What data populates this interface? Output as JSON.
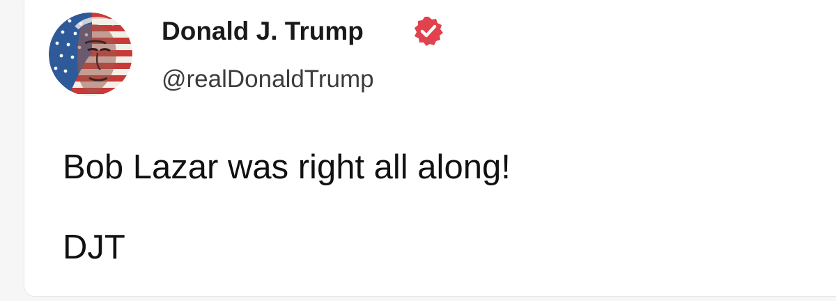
{
  "post": {
    "author": {
      "display_name": "Donald J. Trump",
      "handle": "@realDonaldTrump",
      "verified": true,
      "verified_icon": "verified-badge-icon",
      "verified_color": "#e0424e",
      "avatar": "profile-avatar-flag-portrait"
    },
    "body": "Bob Lazar was right all along!",
    "signature": "DJT"
  }
}
